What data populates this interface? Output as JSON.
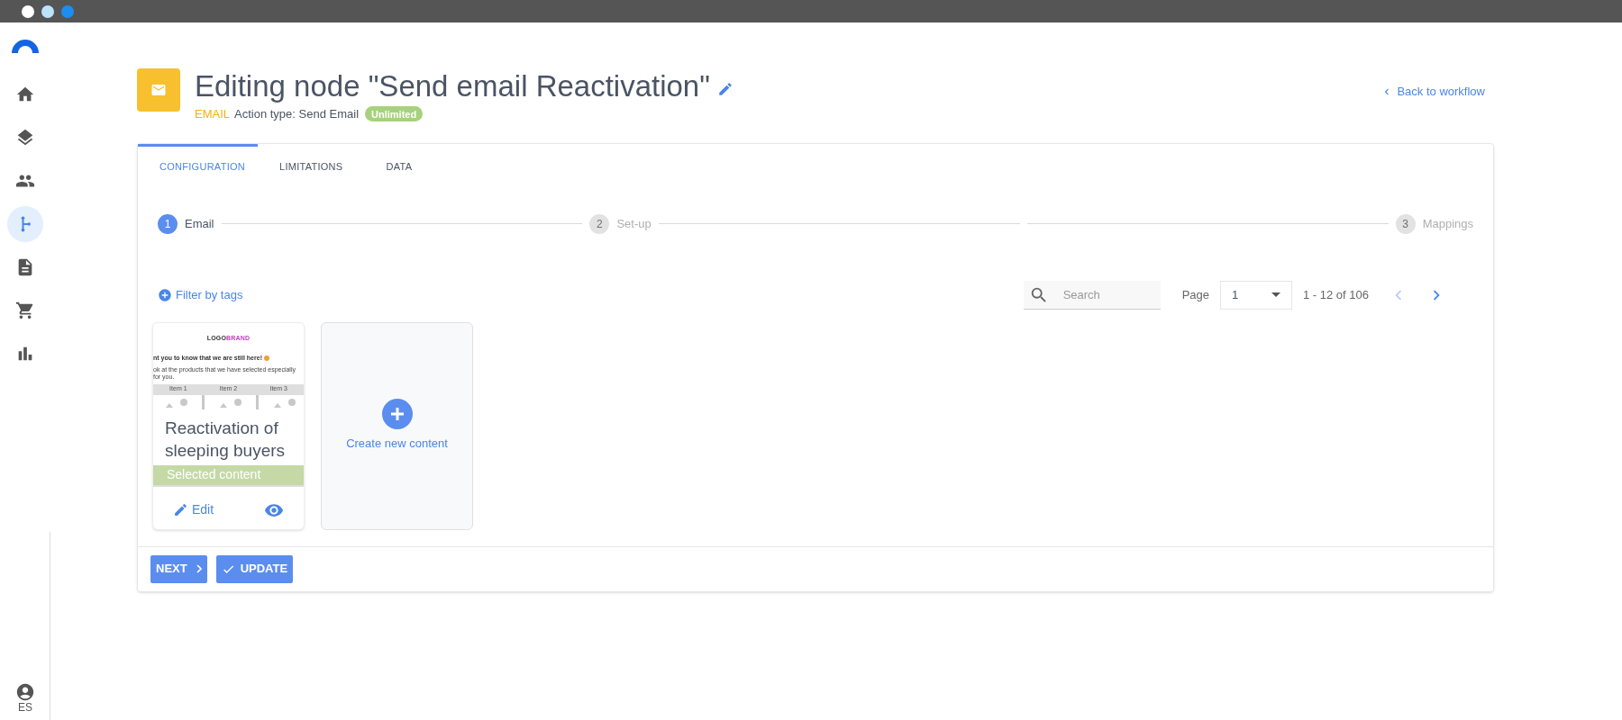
{
  "sidebar": {
    "items": [
      {
        "selected": false
      },
      {
        "selected": false
      },
      {
        "selected": false
      },
      {
        "selected": true
      },
      {
        "selected": false
      },
      {
        "selected": false
      },
      {
        "selected": false
      }
    ],
    "user": "ES"
  },
  "header": {
    "title": "Editing node \"Send email Reactivation\"",
    "type": "EMAIL",
    "action": "Action type: Send Email",
    "badge": "Unlimited",
    "back": "Back to workflow"
  },
  "tabs": [
    {
      "label": "CONFIGURATION",
      "selected": true
    },
    {
      "label": "LIMITATIONS",
      "selected": false
    },
    {
      "label": "DATA",
      "selected": false
    }
  ],
  "steps": [
    {
      "number": "1",
      "label": "Email",
      "active": true
    },
    {
      "number": "2",
      "label": "Set-up",
      "active": false
    },
    {
      "number": "3",
      "label": "Mappings",
      "active": false
    }
  ],
  "filter": "Filter by tags",
  "search": {
    "placeholder": "Search"
  },
  "pagination": {
    "label": "Page",
    "value": "1",
    "range": "1 - 12 of 106"
  },
  "templates": [
    {
      "preview": {
        "logo_a": "LOGO",
        "logo_b": "BRAND",
        "headline": "nt you to know that we are still here!",
        "body": "ok at the products that we have selected especially for you.",
        "items": [
          "Item 1",
          "Item 2",
          "Item 3"
        ]
      },
      "title": "Reactivation of sleeping buyers",
      "selected": true,
      "selected_label": "Selected content",
      "edit": "Edit"
    }
  ],
  "create": "Create new content",
  "buttons": [
    {
      "label": "NEXT",
      "kind": "next"
    },
    {
      "label": "UPDATE",
      "kind": "update"
    }
  ]
}
